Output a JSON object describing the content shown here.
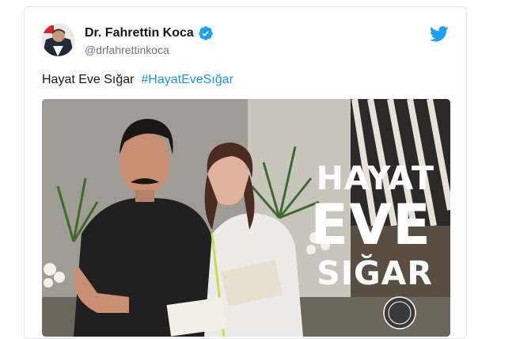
{
  "tweet": {
    "display_name": "Dr. Fahrettin Koca",
    "handle": "@drfahrettinkoca",
    "text": "Hayat Eve Sığar",
    "hashtag": "#HayatEveSığar",
    "verified_icon": "verified-badge-icon",
    "platform_icon": "twitter-bird-icon"
  },
  "media": {
    "overlay_lines": [
      "HAYAT",
      "EVE",
      "SIĞAR"
    ]
  },
  "colors": {
    "link": "#1b95e0",
    "verified": "#1da1f2",
    "text": "#14171a",
    "secondary": "#657786"
  }
}
